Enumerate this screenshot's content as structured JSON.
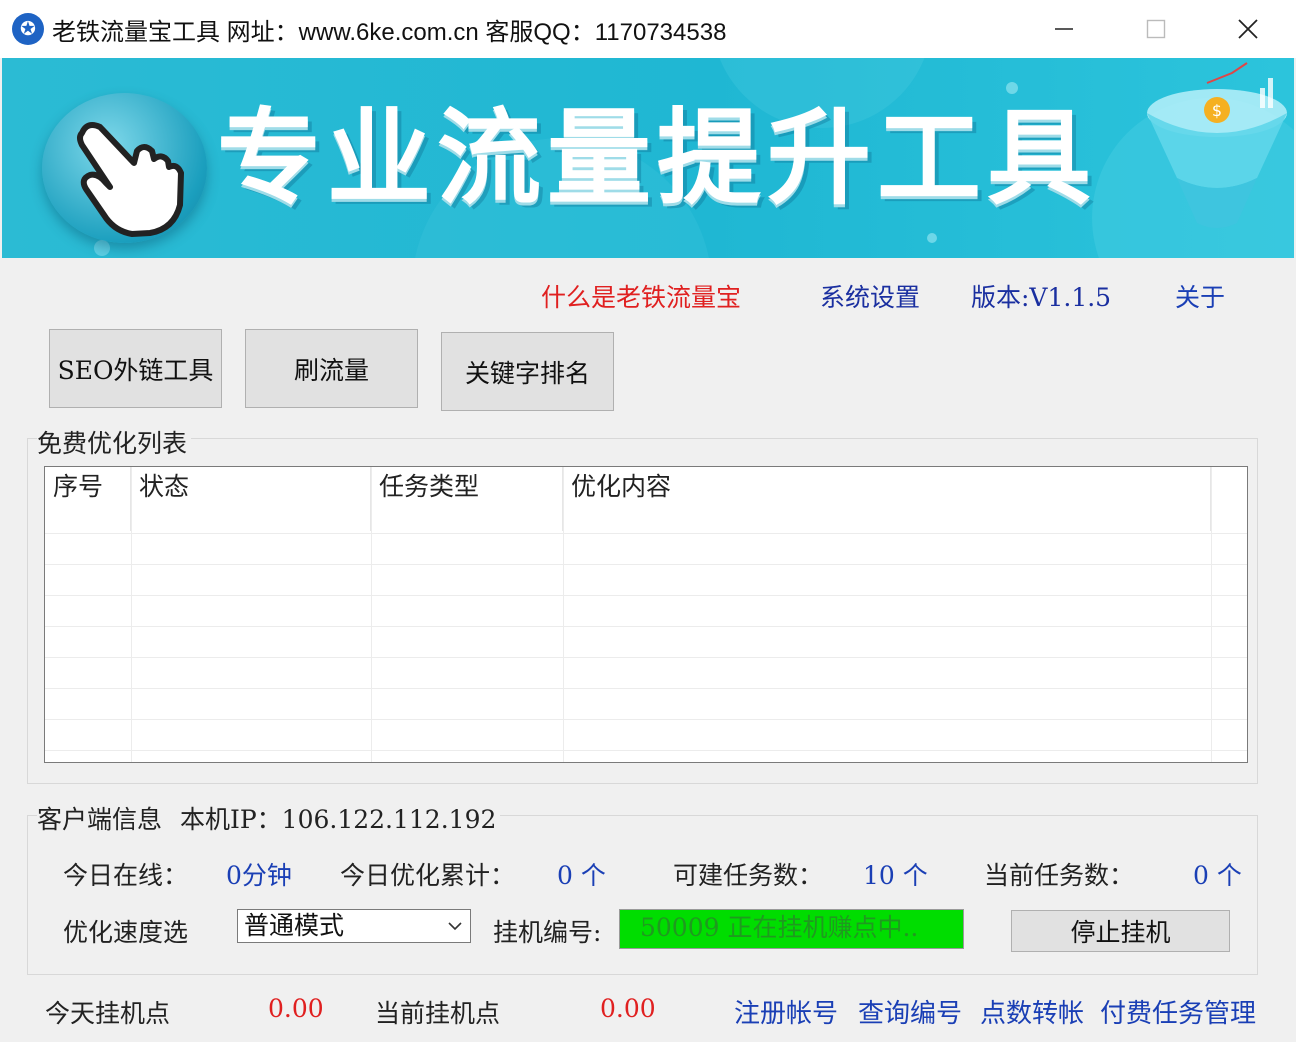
{
  "window": {
    "title": "老铁流量宝工具 网址：www.6ke.com.cn 客服QQ：1170734538",
    "minimize_glyph": "—",
    "maximize_glyph": "☐",
    "close_glyph": "✕"
  },
  "banner": {
    "title": "专业流量提升工具",
    "accent": "#1fb7d3"
  },
  "top_links": {
    "what_is": "什么是老铁流量宝",
    "settings": "系统设置",
    "version": "版本:V1.1.5",
    "about": "关于"
  },
  "tools": {
    "seo": "SEO外链工具",
    "traffic": "刷流量",
    "keyword": "关键字排名"
  },
  "optimize_list": {
    "label": "免费优化列表",
    "columns": [
      "序号",
      "状态",
      "任务类型",
      "优化内容"
    ],
    "rows": []
  },
  "client_info": {
    "label": "客户端信息",
    "ip_label": "本机IP：",
    "ip": "106.122.112.192",
    "online_label": "今日在线：",
    "online_value": "0分钟",
    "optimized_label": "今日优化累计：",
    "optimized_value": "0 个",
    "creatable_label": "可建任务数：",
    "creatable_value": "10 个",
    "current_label": "当前任务数：",
    "current_value": "0 个",
    "speed_label": "优化速度选",
    "speed_selected": "普通模式",
    "hang_label": "挂机编号:",
    "hang_status": "50009 正在挂机赚点中..",
    "stop_button": "停止挂机"
  },
  "footer": {
    "today_points_label": "今天挂机点",
    "today_points": "0.00",
    "current_points_label": "当前挂机点",
    "current_points": "0.00",
    "register": "注册帐号",
    "query": "查询编号",
    "transfer": "点数转帐",
    "paid_tasks": "付费任务管理"
  },
  "colors": {
    "link_red": "#e02020",
    "link_blue": "#1a3fb5",
    "status_green": "#00dd00"
  }
}
